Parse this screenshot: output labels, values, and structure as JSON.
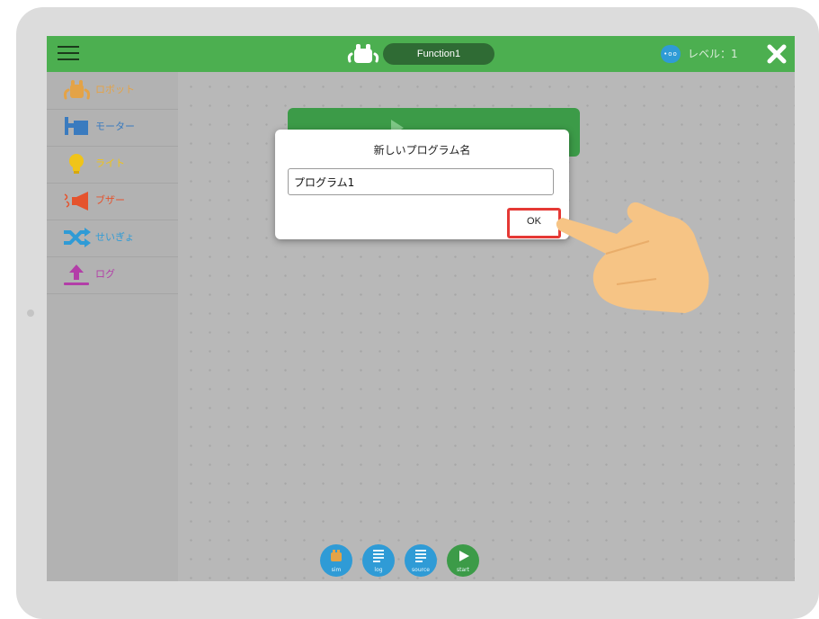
{
  "header": {
    "function_name": "Function1",
    "level_badge": "•oo",
    "level_text": "レベル：1"
  },
  "sidebar": {
    "items": [
      {
        "label": "ロボット",
        "icon": "robot-icon",
        "color": "#e4a347"
      },
      {
        "label": "モーター",
        "icon": "motor-icon",
        "color": "#3a7bbf"
      },
      {
        "label": "ライト",
        "icon": "lightbulb-icon",
        "color": "#f0c419"
      },
      {
        "label": "ブザー",
        "icon": "buzzer-icon",
        "color": "#e5532d"
      },
      {
        "label": "せいぎょ",
        "icon": "shuffle-icon",
        "color": "#2f9bd6"
      },
      {
        "label": "ログ",
        "icon": "upload-log-icon",
        "color": "#b33ea8"
      }
    ]
  },
  "dialog": {
    "title": "新しいプログラム名",
    "input_value": "プログラム1",
    "ok_label": "OK"
  },
  "toolbar": {
    "sim_label": "sim",
    "log_label": "log",
    "source_label": "source",
    "start_label": "start"
  },
  "colors": {
    "topbar": "#4caf50",
    "highlight": "#e53935",
    "tool_blue": "#2f9bd6",
    "tool_green": "#3c9b48"
  }
}
